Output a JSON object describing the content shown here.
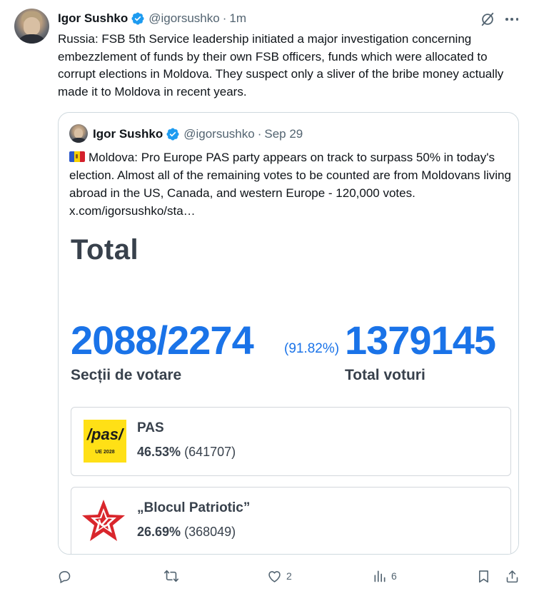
{
  "tweet": {
    "author_name": "Igor Sushko",
    "handle": "@igorsushko",
    "separator": "·",
    "time": "1m",
    "text": "Russia: FSB 5th Service leadership initiated a major investigation concerning embezzlement of funds by their own FSB officers, funds which were allocated to corrupt elections in Moldova. They suspect only a sliver of the bribe money actually made it to Moldova in recent years.",
    "verified_color": "#1d9bf0"
  },
  "quote": {
    "author_name": "Igor Sushko",
    "handle": "@igorsushko",
    "separator": "·",
    "time": "Sep 29",
    "text": "Moldova: Pro Europe PAS party appears on track to surpass 50% in today's election. Almost all of the remaining votes to be counted are from Moldovans living abroad in the US, Canada, and western Europe - 120,000 votes.  x.com/igorsushko/sta…",
    "flag_icon": "moldova-flag-icon"
  },
  "media": {
    "heading": "Total",
    "sections": "2088/2274",
    "sections_pct": "(91.82%)",
    "sections_label": "Secții de votare",
    "total_votes": "1379145",
    "total_votes_label": "Total voturi",
    "accent_color": "#1a73e8",
    "parties": [
      {
        "name": "PAS",
        "percent": "46.53%",
        "votes": "(641707)",
        "logo_text": "/pas/",
        "logo_subtext": "UE 2028",
        "logo_color": "#ffe016"
      },
      {
        "name": "„Blocul Patriotic”",
        "percent": "26.69%",
        "votes": "(368049)",
        "logo_icon": "red-star-icon",
        "logo_color": "#d9262c"
      }
    ]
  },
  "actions": {
    "reply_count": "",
    "repost_count": "",
    "like_count": "2",
    "views_count": "6"
  }
}
